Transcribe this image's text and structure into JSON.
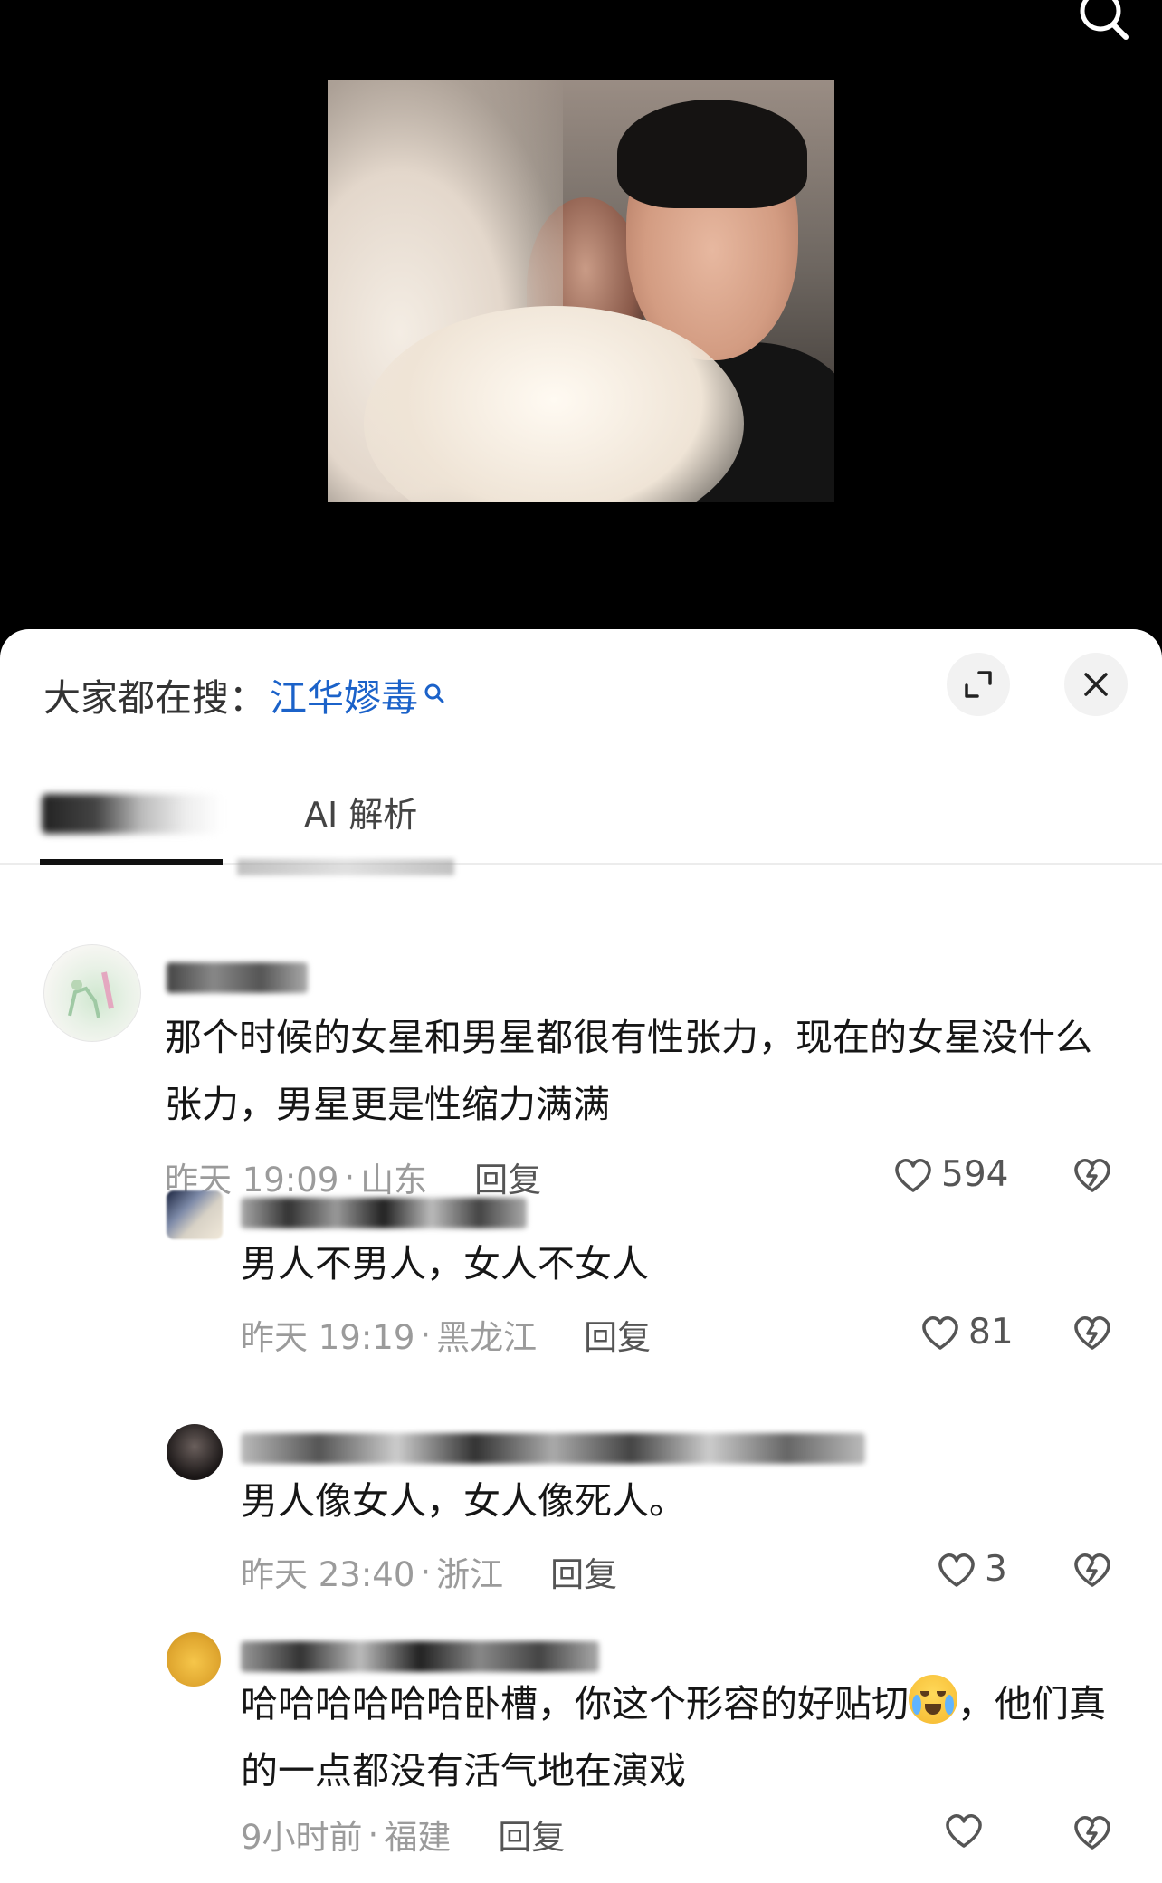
{
  "hot_search": {
    "prefix": "大家都在搜：",
    "term": "江华嫪毒"
  },
  "tabs": [
    {
      "label": "AI 解析"
    }
  ],
  "comments": [
    {
      "text": "那个时候的女星和男星都很有性张力，现在的女星没什么张力，男星更是性缩力满满",
      "time": "昨天 19:09",
      "sep": "·",
      "location": "山东",
      "reply": "回复",
      "likes": "594"
    },
    {
      "text": "男人不男人，女人不女人",
      "time": "昨天 19:19",
      "sep": "·",
      "location": "黑龙江",
      "reply": "回复",
      "likes": "81"
    },
    {
      "text": "男人像女人，女人像死人。",
      "time": "昨天 23:40",
      "sep": "·",
      "location": "浙江",
      "reply": "回复",
      "likes": "3"
    },
    {
      "text_a": "哈哈哈哈哈哈卧槽，你这个形容的好贴切",
      "text_b": "，他们真的一点都没有活气地在演戏",
      "time": "9小时前",
      "sep": "·",
      "location": "福建",
      "reply": "回复",
      "likes": ""
    }
  ],
  "icons": {
    "search": "search-icon",
    "expand": "expand-icon",
    "close": "close-icon",
    "heart": "heart-icon",
    "dislike": "broken-heart-icon",
    "emoji": "crying-laughing-emoji-icon"
  }
}
